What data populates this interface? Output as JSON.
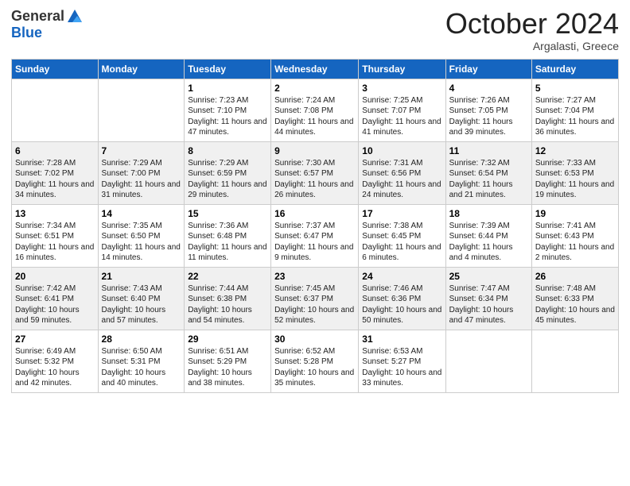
{
  "header": {
    "logo_general": "General",
    "logo_blue": "Blue",
    "month": "October 2024",
    "location": "Argalasti, Greece"
  },
  "days_of_week": [
    "Sunday",
    "Monday",
    "Tuesday",
    "Wednesday",
    "Thursday",
    "Friday",
    "Saturday"
  ],
  "weeks": [
    [
      {
        "day": "",
        "info": ""
      },
      {
        "day": "",
        "info": ""
      },
      {
        "day": "1",
        "info": "Sunrise: 7:23 AM\nSunset: 7:10 PM\nDaylight: 11 hours and 47 minutes."
      },
      {
        "day": "2",
        "info": "Sunrise: 7:24 AM\nSunset: 7:08 PM\nDaylight: 11 hours and 44 minutes."
      },
      {
        "day": "3",
        "info": "Sunrise: 7:25 AM\nSunset: 7:07 PM\nDaylight: 11 hours and 41 minutes."
      },
      {
        "day": "4",
        "info": "Sunrise: 7:26 AM\nSunset: 7:05 PM\nDaylight: 11 hours and 39 minutes."
      },
      {
        "day": "5",
        "info": "Sunrise: 7:27 AM\nSunset: 7:04 PM\nDaylight: 11 hours and 36 minutes."
      }
    ],
    [
      {
        "day": "6",
        "info": "Sunrise: 7:28 AM\nSunset: 7:02 PM\nDaylight: 11 hours and 34 minutes."
      },
      {
        "day": "7",
        "info": "Sunrise: 7:29 AM\nSunset: 7:00 PM\nDaylight: 11 hours and 31 minutes."
      },
      {
        "day": "8",
        "info": "Sunrise: 7:29 AM\nSunset: 6:59 PM\nDaylight: 11 hours and 29 minutes."
      },
      {
        "day": "9",
        "info": "Sunrise: 7:30 AM\nSunset: 6:57 PM\nDaylight: 11 hours and 26 minutes."
      },
      {
        "day": "10",
        "info": "Sunrise: 7:31 AM\nSunset: 6:56 PM\nDaylight: 11 hours and 24 minutes."
      },
      {
        "day": "11",
        "info": "Sunrise: 7:32 AM\nSunset: 6:54 PM\nDaylight: 11 hours and 21 minutes."
      },
      {
        "day": "12",
        "info": "Sunrise: 7:33 AM\nSunset: 6:53 PM\nDaylight: 11 hours and 19 minutes."
      }
    ],
    [
      {
        "day": "13",
        "info": "Sunrise: 7:34 AM\nSunset: 6:51 PM\nDaylight: 11 hours and 16 minutes."
      },
      {
        "day": "14",
        "info": "Sunrise: 7:35 AM\nSunset: 6:50 PM\nDaylight: 11 hours and 14 minutes."
      },
      {
        "day": "15",
        "info": "Sunrise: 7:36 AM\nSunset: 6:48 PM\nDaylight: 11 hours and 11 minutes."
      },
      {
        "day": "16",
        "info": "Sunrise: 7:37 AM\nSunset: 6:47 PM\nDaylight: 11 hours and 9 minutes."
      },
      {
        "day": "17",
        "info": "Sunrise: 7:38 AM\nSunset: 6:45 PM\nDaylight: 11 hours and 6 minutes."
      },
      {
        "day": "18",
        "info": "Sunrise: 7:39 AM\nSunset: 6:44 PM\nDaylight: 11 hours and 4 minutes."
      },
      {
        "day": "19",
        "info": "Sunrise: 7:41 AM\nSunset: 6:43 PM\nDaylight: 11 hours and 2 minutes."
      }
    ],
    [
      {
        "day": "20",
        "info": "Sunrise: 7:42 AM\nSunset: 6:41 PM\nDaylight: 10 hours and 59 minutes."
      },
      {
        "day": "21",
        "info": "Sunrise: 7:43 AM\nSunset: 6:40 PM\nDaylight: 10 hours and 57 minutes."
      },
      {
        "day": "22",
        "info": "Sunrise: 7:44 AM\nSunset: 6:38 PM\nDaylight: 10 hours and 54 minutes."
      },
      {
        "day": "23",
        "info": "Sunrise: 7:45 AM\nSunset: 6:37 PM\nDaylight: 10 hours and 52 minutes."
      },
      {
        "day": "24",
        "info": "Sunrise: 7:46 AM\nSunset: 6:36 PM\nDaylight: 10 hours and 50 minutes."
      },
      {
        "day": "25",
        "info": "Sunrise: 7:47 AM\nSunset: 6:34 PM\nDaylight: 10 hours and 47 minutes."
      },
      {
        "day": "26",
        "info": "Sunrise: 7:48 AM\nSunset: 6:33 PM\nDaylight: 10 hours and 45 minutes."
      }
    ],
    [
      {
        "day": "27",
        "info": "Sunrise: 6:49 AM\nSunset: 5:32 PM\nDaylight: 10 hours and 42 minutes."
      },
      {
        "day": "28",
        "info": "Sunrise: 6:50 AM\nSunset: 5:31 PM\nDaylight: 10 hours and 40 minutes."
      },
      {
        "day": "29",
        "info": "Sunrise: 6:51 AM\nSunset: 5:29 PM\nDaylight: 10 hours and 38 minutes."
      },
      {
        "day": "30",
        "info": "Sunrise: 6:52 AM\nSunset: 5:28 PM\nDaylight: 10 hours and 35 minutes."
      },
      {
        "day": "31",
        "info": "Sunrise: 6:53 AM\nSunset: 5:27 PM\nDaylight: 10 hours and 33 minutes."
      },
      {
        "day": "",
        "info": ""
      },
      {
        "day": "",
        "info": ""
      }
    ]
  ]
}
